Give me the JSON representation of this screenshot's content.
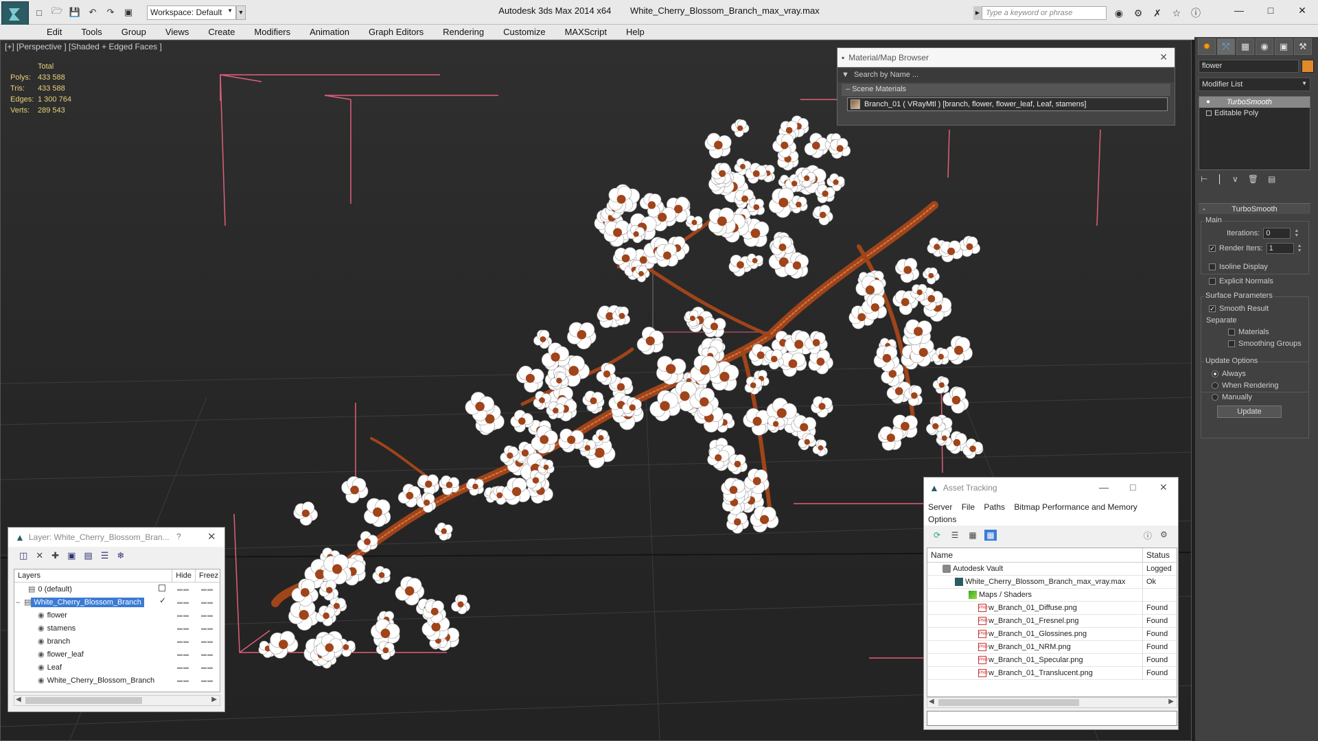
{
  "titlebar": {
    "workspace": "Workspace: Default",
    "app_name": "Autodesk 3ds Max  2014 x64",
    "file_name": "White_Cherry_Blossom_Branch_max_vray.max",
    "search_placeholder": "Type a keyword or phrase"
  },
  "menu": [
    "Edit",
    "Tools",
    "Group",
    "Views",
    "Create",
    "Modifiers",
    "Animation",
    "Graph Editors",
    "Rendering",
    "Customize",
    "MAXScript",
    "Help"
  ],
  "viewport": {
    "label": "[+] [Perspective ] [Shaded + Edged Faces ]",
    "stats": {
      "header": "Total",
      "polys_label": "Polys:",
      "polys": "433 588",
      "tris_label": "Tris:",
      "tris": "433 588",
      "edges_label": "Edges:",
      "edges": "1 300 764",
      "verts_label": "Verts:",
      "verts": "289 543"
    },
    "colors": {
      "flower": "#ffffff",
      "branch": "#a0441a",
      "bbox": "#e0607a"
    }
  },
  "material_browser": {
    "title": "Material/Map Browser",
    "search": "Search by Name ...",
    "group": "Scene Materials",
    "item": "Branch_01  ( VRayMtl )  [branch, flower, flower_leaf, Leaf, stamens]"
  },
  "command_panel": {
    "object_name": "flower",
    "modifier_list": "Modifier List",
    "stack": [
      "TurboSmooth",
      "Editable Poly"
    ],
    "rollout_title": "TurboSmooth",
    "main_label": "Main",
    "iterations_label": "Iterations:",
    "iterations": "0",
    "render_iters_label": "Render Iters:",
    "render_iters": "1",
    "isoline": "Isoline Display",
    "explicit_normals": "Explicit Normals",
    "surface_params": "Surface Parameters",
    "smooth_result": "Smooth Result",
    "separate": "Separate",
    "materials": "Materials",
    "smoothing_groups": "Smoothing Groups",
    "update_options": "Update Options",
    "always": "Always",
    "when_rendering": "When Rendering",
    "manually": "Manually",
    "update_button": "Update"
  },
  "layer_panel": {
    "title": "Layer: White_Cherry_Blossom_Bran...",
    "col_layers": "Layers",
    "col_hide": "Hide",
    "col_freeze": "Freez",
    "rows": [
      {
        "name": "0 (default)"
      },
      {
        "name": "White_Cherry_Blossom_Branch"
      },
      {
        "name": "flower"
      },
      {
        "name": "stamens"
      },
      {
        "name": "branch"
      },
      {
        "name": "flower_leaf"
      },
      {
        "name": "Leaf"
      },
      {
        "name": "White_Cherry_Blossom_Branch"
      }
    ]
  },
  "asset_tracking": {
    "title": "Asset Tracking",
    "menu": [
      "Server",
      "File",
      "Paths",
      "Bitmap Performance and Memory",
      "Options"
    ],
    "col_name": "Name",
    "col_status": "Status",
    "rows": [
      {
        "name": "Autodesk Vault",
        "status": "Logged"
      },
      {
        "name": "White_Cherry_Blossom_Branch_max_vray.max",
        "status": "Ok"
      },
      {
        "name": "Maps / Shaders",
        "status": ""
      },
      {
        "name": "w_Branch_01_Diffuse.png",
        "status": "Found"
      },
      {
        "name": "w_Branch_01_Fresnel.png",
        "status": "Found"
      },
      {
        "name": "w_Branch_01_Glossines.png",
        "status": "Found"
      },
      {
        "name": "w_Branch_01_NRM.png",
        "status": "Found"
      },
      {
        "name": "w_Branch_01_Specular.png",
        "status": "Found"
      },
      {
        "name": "w_Branch_01_Translucent.png",
        "status": "Found"
      }
    ]
  }
}
